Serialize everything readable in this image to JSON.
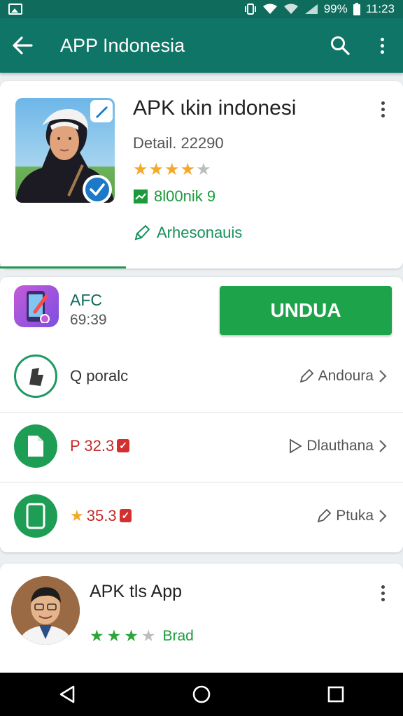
{
  "status_bar": {
    "battery": "99%",
    "time": "11:23"
  },
  "app_bar": {
    "title": "APP Indonesia"
  },
  "hero": {
    "title": "APK ɩkin indonesi",
    "detail": "Detail. 22290",
    "rating": 4,
    "rating_max": 5,
    "stat": "8l00nik 9",
    "link": "Arhesonauis"
  },
  "featured": {
    "name": "AFC",
    "time": "69:39",
    "install_label": "UNDUA"
  },
  "rows": [
    {
      "label": "Q poralc",
      "right": "Andoura"
    },
    {
      "label": "P 32.3",
      "right": "Dlauthana"
    },
    {
      "label": "35.3",
      "right": "Ptuka"
    }
  ],
  "second": {
    "title": "APK tls App",
    "rating": 3,
    "rating_max": 4,
    "label": "Brad"
  },
  "colors": {
    "primary": "#0f7566",
    "install": "#1da349",
    "accent": "#14905a"
  }
}
